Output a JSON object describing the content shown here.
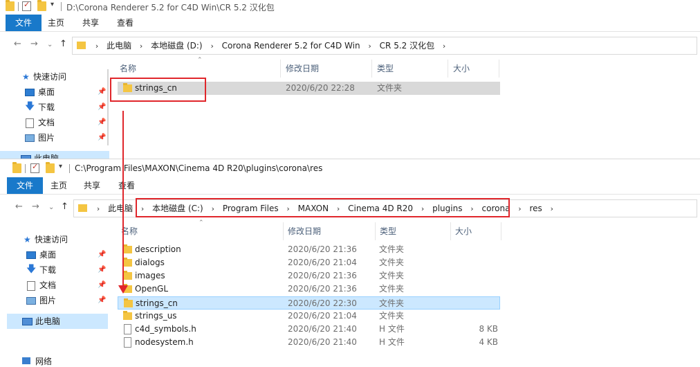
{
  "window1": {
    "title": "D:\\Corona Renderer 5.2 for C4D Win\\CR 5.2 汉化包",
    "ribbon_tabs": [
      "文件",
      "主页",
      "共享",
      "查看"
    ],
    "breadcrumbs": [
      "此电脑",
      "本地磁盘 (D:)",
      "Corona Renderer 5.2 for C4D Win",
      "CR 5.2 汉化包"
    ],
    "sidebar": [
      {
        "label": "快速访问",
        "icon": "star-icon"
      },
      {
        "label": "桌面",
        "icon": "desktop-icon",
        "pinned": true
      },
      {
        "label": "下载",
        "icon": "download-icon",
        "pinned": true
      },
      {
        "label": "文档",
        "icon": "document-icon",
        "pinned": true
      },
      {
        "label": "图片",
        "icon": "pictures-icon",
        "pinned": true
      },
      {
        "label": "此电脑",
        "icon": "computer-icon"
      }
    ],
    "columns": [
      "名称",
      "修改日期",
      "类型",
      "大小"
    ],
    "rows": [
      {
        "name": "strings_cn",
        "date": "2020/6/20 22:28",
        "type": "文件夹",
        "size": ""
      }
    ]
  },
  "window2": {
    "title": "C:\\Program Files\\MAXON\\Cinema 4D R20\\plugins\\corona\\res",
    "ribbon_tabs": [
      "文件",
      "主页",
      "共享",
      "查看"
    ],
    "breadcrumbs": [
      "此电脑",
      "本地磁盘 (C:)",
      "Program Files",
      "MAXON",
      "Cinema 4D R20",
      "plugins",
      "corona",
      "res"
    ],
    "sidebar": [
      {
        "label": "快速访问",
        "icon": "star-icon"
      },
      {
        "label": "桌面",
        "icon": "desktop-icon",
        "pinned": true
      },
      {
        "label": "下载",
        "icon": "download-icon",
        "pinned": true
      },
      {
        "label": "文档",
        "icon": "document-icon",
        "pinned": true
      },
      {
        "label": "图片",
        "icon": "pictures-icon",
        "pinned": true
      },
      {
        "label": "此电脑",
        "icon": "computer-icon"
      },
      {
        "label": "网络",
        "icon": "network-icon"
      }
    ],
    "columns": [
      "名称",
      "修改日期",
      "类型",
      "大小"
    ],
    "rows": [
      {
        "name": "description",
        "date": "2020/6/20 21:36",
        "type": "文件夹",
        "size": "",
        "kind": "folder"
      },
      {
        "name": "dialogs",
        "date": "2020/6/20 21:04",
        "type": "文件夹",
        "size": "",
        "kind": "folder"
      },
      {
        "name": "images",
        "date": "2020/6/20 21:36",
        "type": "文件夹",
        "size": "",
        "kind": "folder"
      },
      {
        "name": "OpenGL",
        "date": "2020/6/20 21:36",
        "type": "文件夹",
        "size": "",
        "kind": "folder"
      },
      {
        "name": "strings_cn",
        "date": "2020/6/20 22:30",
        "type": "文件夹",
        "size": "",
        "kind": "folder"
      },
      {
        "name": "strings_us",
        "date": "2020/6/20 21:04",
        "type": "文件夹",
        "size": "",
        "kind": "folder"
      },
      {
        "name": "c4d_symbols.h",
        "date": "2020/6/20 21:40",
        "type": "H 文件",
        "size": "8 KB",
        "kind": "file"
      },
      {
        "name": "nodesystem.h",
        "date": "2020/6/20 21:40",
        "type": "H 文件",
        "size": "4 KB",
        "kind": "file"
      }
    ]
  },
  "colors": {
    "accent": "#1979ca",
    "selection": "#cce8ff",
    "annotation": "#e0262b"
  }
}
